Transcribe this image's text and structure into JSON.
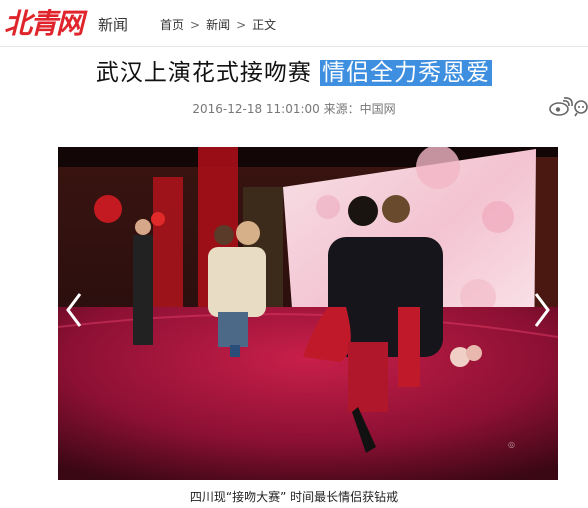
{
  "header": {
    "logo_text": "北青网",
    "section_label": "新闻",
    "breadcrumb": [
      {
        "label": "首页"
      },
      {
        "label": "新闻"
      },
      {
        "label": "正文"
      }
    ],
    "separator": ">"
  },
  "article": {
    "title_main": "武汉上演花式接吻赛",
    "title_highlight": "情侣全力秀恩爱",
    "meta": "2016-12-18 11:01:00 来源：中国网",
    "share_icon": "weibo-icon",
    "gallery": {
      "prev_icon": "chevron-left-icon",
      "next_icon": "chevron-right-icon",
      "caption": "四川现“接吻大赛” 时间最长情侣获钻戒"
    }
  },
  "colors": {
    "logo_red": "#e0242c",
    "highlight_blue": "#3e8fe0"
  }
}
